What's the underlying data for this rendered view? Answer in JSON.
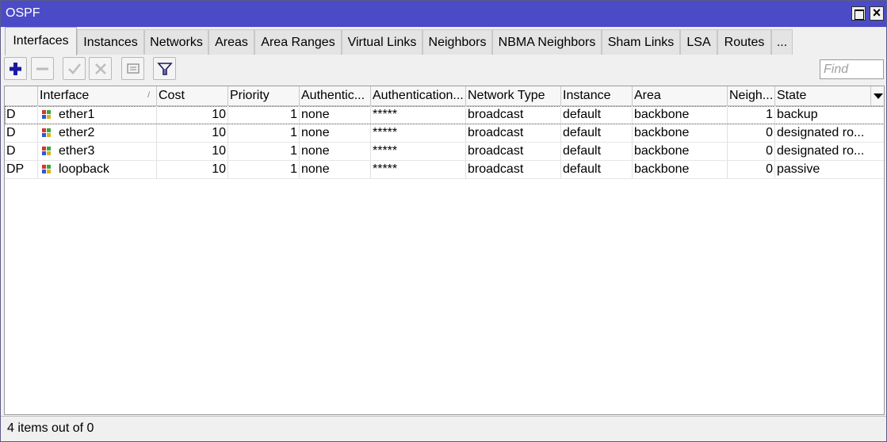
{
  "window": {
    "title": "OSPF"
  },
  "tabs": [
    {
      "label": "Interfaces"
    },
    {
      "label": "Instances"
    },
    {
      "label": "Networks"
    },
    {
      "label": "Areas"
    },
    {
      "label": "Area Ranges"
    },
    {
      "label": "Virtual Links"
    },
    {
      "label": "Neighbors"
    },
    {
      "label": "NBMA Neighbors"
    },
    {
      "label": "Sham Links"
    },
    {
      "label": "LSA"
    },
    {
      "label": "Routes"
    },
    {
      "label": "..."
    }
  ],
  "toolbar": {
    "find_placeholder": "Find",
    "icons": [
      "add-icon",
      "remove-icon",
      "enable-icon",
      "disable-icon",
      "comment-icon",
      "filter-icon"
    ]
  },
  "table": {
    "columns": [
      "",
      "Interface",
      "Cost",
      "Priority",
      "Authentic...",
      "Authentication...",
      "Network Type",
      "Instance",
      "Area",
      "Neigh...",
      "State"
    ],
    "rows": [
      {
        "flags": "D",
        "interface": "ether1",
        "cost": "10",
        "priority": "1",
        "auth": "none",
        "auth_key": "*****",
        "network_type": "broadcast",
        "instance": "default",
        "area": "backbone",
        "neighbors": "1",
        "state": "backup"
      },
      {
        "flags": "D",
        "interface": "ether2",
        "cost": "10",
        "priority": "1",
        "auth": "none",
        "auth_key": "*****",
        "network_type": "broadcast",
        "instance": "default",
        "area": "backbone",
        "neighbors": "0",
        "state": "designated ro..."
      },
      {
        "flags": "D",
        "interface": "ether3",
        "cost": "10",
        "priority": "1",
        "auth": "none",
        "auth_key": "*****",
        "network_type": "broadcast",
        "instance": "default",
        "area": "backbone",
        "neighbors": "0",
        "state": "designated ro..."
      },
      {
        "flags": "DP",
        "interface": "loopback",
        "cost": "10",
        "priority": "1",
        "auth": "none",
        "auth_key": "*****",
        "network_type": "broadcast",
        "instance": "default",
        "area": "backbone",
        "neighbors": "0",
        "state": "passive"
      }
    ]
  },
  "status": {
    "text": "4 items out of 0"
  },
  "colors": {
    "titlebar": "#4b4bc8",
    "add_icon": "#1a1aa0"
  }
}
